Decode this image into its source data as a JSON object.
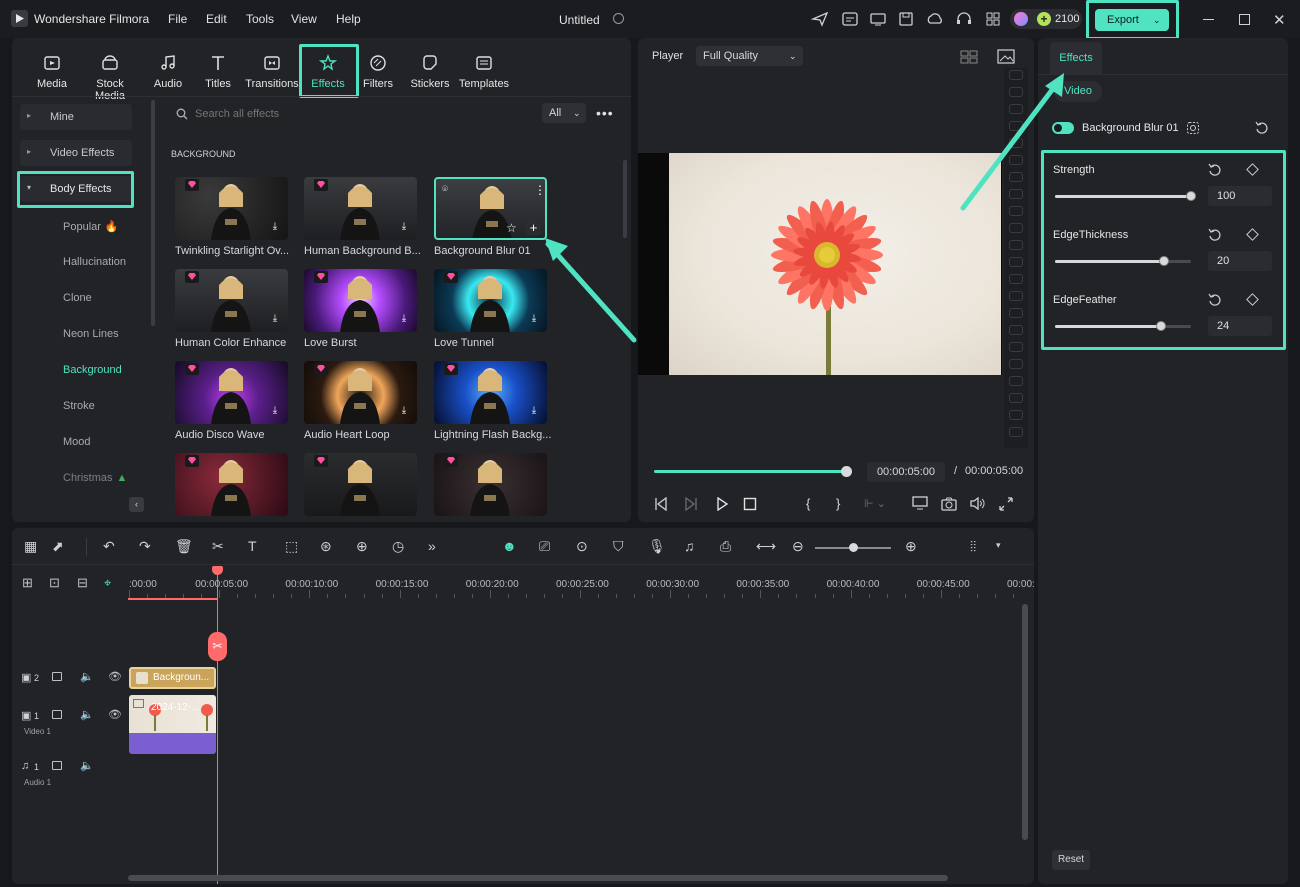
{
  "app": {
    "name": "Wondershare Filmora",
    "project_title": "Untitled",
    "credits": "2100",
    "export_label": "Export"
  },
  "menu": [
    "File",
    "Edit",
    "Tools",
    "View",
    "Help"
  ],
  "tabs": [
    {
      "label": "Media",
      "icon": "media-icon"
    },
    {
      "label": "Stock Media",
      "icon": "stock-media-icon"
    },
    {
      "label": "Audio",
      "icon": "audio-icon"
    },
    {
      "label": "Titles",
      "icon": "titles-icon"
    },
    {
      "label": "Transitions",
      "icon": "transitions-icon"
    },
    {
      "label": "Effects",
      "icon": "effects-icon",
      "active": true
    },
    {
      "label": "Filters",
      "icon": "filters-icon"
    },
    {
      "label": "Stickers",
      "icon": "stickers-icon"
    },
    {
      "label": "Templates",
      "icon": "templates-icon"
    }
  ],
  "sidebar": {
    "categories": [
      "Mine",
      "Video Effects",
      "Body Effects"
    ],
    "subcategories": [
      "Popular",
      "Hallucination",
      "Clone",
      "Neon Lines",
      "Background",
      "Stroke",
      "Mood",
      "Christmas"
    ],
    "active_sub": "Background"
  },
  "search": {
    "placeholder": "Search all effects",
    "filter": "All"
  },
  "section_title": "BACKGROUND",
  "effects": [
    {
      "label": "Twinkling Starlight Ov..."
    },
    {
      "label": "Human Background B..."
    },
    {
      "label": "Background Blur 01"
    },
    {
      "label": "Human Color Enhance"
    },
    {
      "label": "Love Burst"
    },
    {
      "label": "Love Tunnel"
    },
    {
      "label": "Audio Disco Wave"
    },
    {
      "label": "Audio Heart Loop"
    },
    {
      "label": "Lightning Flash Backg..."
    },
    {
      "label": ""
    },
    {
      "label": ""
    },
    {
      "label": ""
    }
  ],
  "player": {
    "label": "Player",
    "quality": "Full Quality",
    "current_time": "00:00:05:00",
    "separator": "/",
    "total_time": "00:00:05:00",
    "progress": 1.0
  },
  "props": {
    "tab": "Effects",
    "subtab": "Video",
    "effect_name": "Background Blur 01",
    "reset_label": "Reset",
    "params": [
      {
        "label": "Strength",
        "value": "100",
        "fraction": 1.0
      },
      {
        "label": "EdgeThickness",
        "value": "20",
        "fraction": 0.8
      },
      {
        "label": "EdgeFeather",
        "value": "24",
        "fraction": 0.78
      }
    ]
  },
  "timeline": {
    "ticks": [
      ":00:00",
      "00:00:05:00",
      "00:00:10:00",
      "00:00:15:00",
      "00:00:20:00",
      "00:00:25:00",
      "00:00:30:00",
      "00:00:35:00",
      "00:00:40:00",
      "00:00:45:00",
      "00:00:"
    ],
    "tracks": [
      {
        "num": "2",
        "name": ""
      },
      {
        "num": "1",
        "name": "Video 1"
      },
      {
        "num": "1",
        "name": "Audio 1"
      }
    ],
    "effect_clip": "Backgroun...",
    "video_clip": "2024-12-..."
  },
  "colors": {
    "accent": "#4fe3c1",
    "playhead": "#ff6b6b",
    "clip_effect": "#c9a45a",
    "clip_video": "#7b5fd0"
  }
}
